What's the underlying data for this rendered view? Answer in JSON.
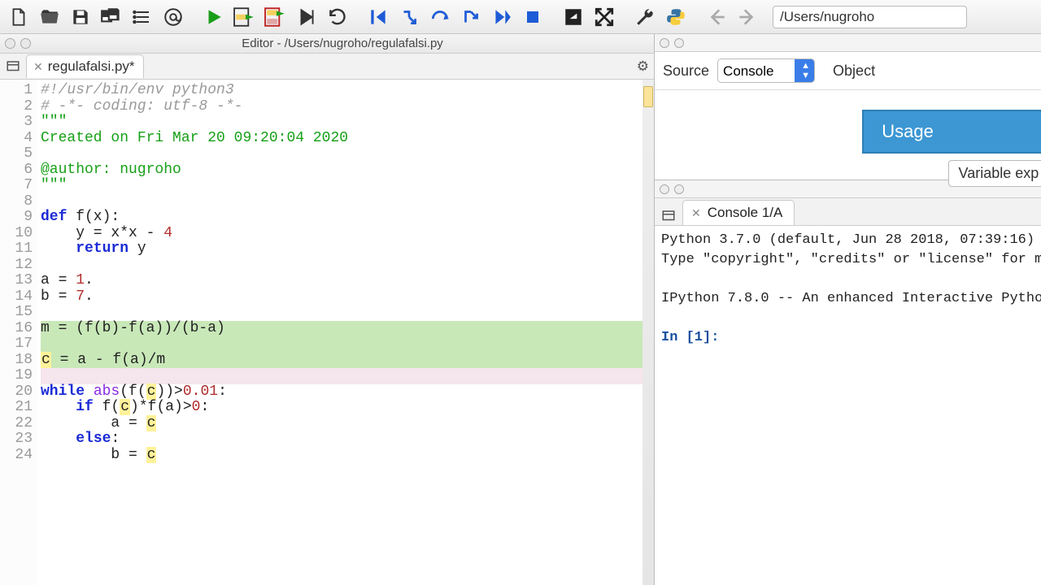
{
  "path_bar": "/Users/nugroho",
  "editor": {
    "title": "Editor - /Users/nugroho/regulafalsi.py",
    "tab_name": "regulafalsi.py*"
  },
  "code": {
    "line_count": 24,
    "lines_plain": [
      "#!/usr/bin/env python3",
      "# -*- coding: utf-8 -*-",
      "\"\"\"",
      "Created on Fri Mar 20 09:20:04 2020",
      "",
      "@author: nugroho",
      "\"\"\"",
      "",
      "def f(x):",
      "    y = x*x - 4",
      "    return y",
      "",
      "a = 1.",
      "b = 7.",
      "",
      "m = (f(b)-f(a))/(b-a)",
      "",
      "c = a - f(a)/m",
      "",
      "while abs(f(c))>0.01:",
      "    if f(c)*f(a)>0:",
      "        a = c",
      "    else:",
      "        b = c"
    ],
    "highlighted_green_lines": [
      16,
      17,
      18
    ],
    "highlighted_pink_lines": [
      19
    ]
  },
  "right_panel": {
    "source_label": "Source",
    "select_value": "Console",
    "object_label": "Object",
    "usage_button": "Usage",
    "variable_link": "Variable exp"
  },
  "console": {
    "tab_label": "Console 1/A",
    "body_lines": [
      "Python 3.7.0 (default, Jun 28 2018, 07:39:16) ",
      "Type \"copyright\", \"credits\" or \"license\" for m",
      "",
      "IPython 7.8.0 -- An enhanced Interactive Pytho",
      ""
    ],
    "prompt": "In [1]: "
  },
  "icons": {
    "new": "new-file-icon",
    "open": "open-folder-icon",
    "save": "save-icon",
    "saveall": "save-all-icon",
    "list": "list-icon",
    "at": "at-icon",
    "run": "run-icon",
    "runcell": "run-cell-icon",
    "runcell2": "run-cell-advance-icon",
    "debug": "debug-icon",
    "restart": "restart-icon",
    "first": "goto-first-icon",
    "stepin": "step-in-icon",
    "stepover": "step-over-icon",
    "stepover2": "step-over-line-icon",
    "stepout": "step-out-icon",
    "stop": "stop-icon",
    "maximize": "maximize-icon",
    "fullscreen": "fullscreen-icon",
    "wrench": "wrench-icon",
    "python": "python-icon",
    "back": "arrow-left-icon",
    "fwd": "arrow-right-icon"
  }
}
